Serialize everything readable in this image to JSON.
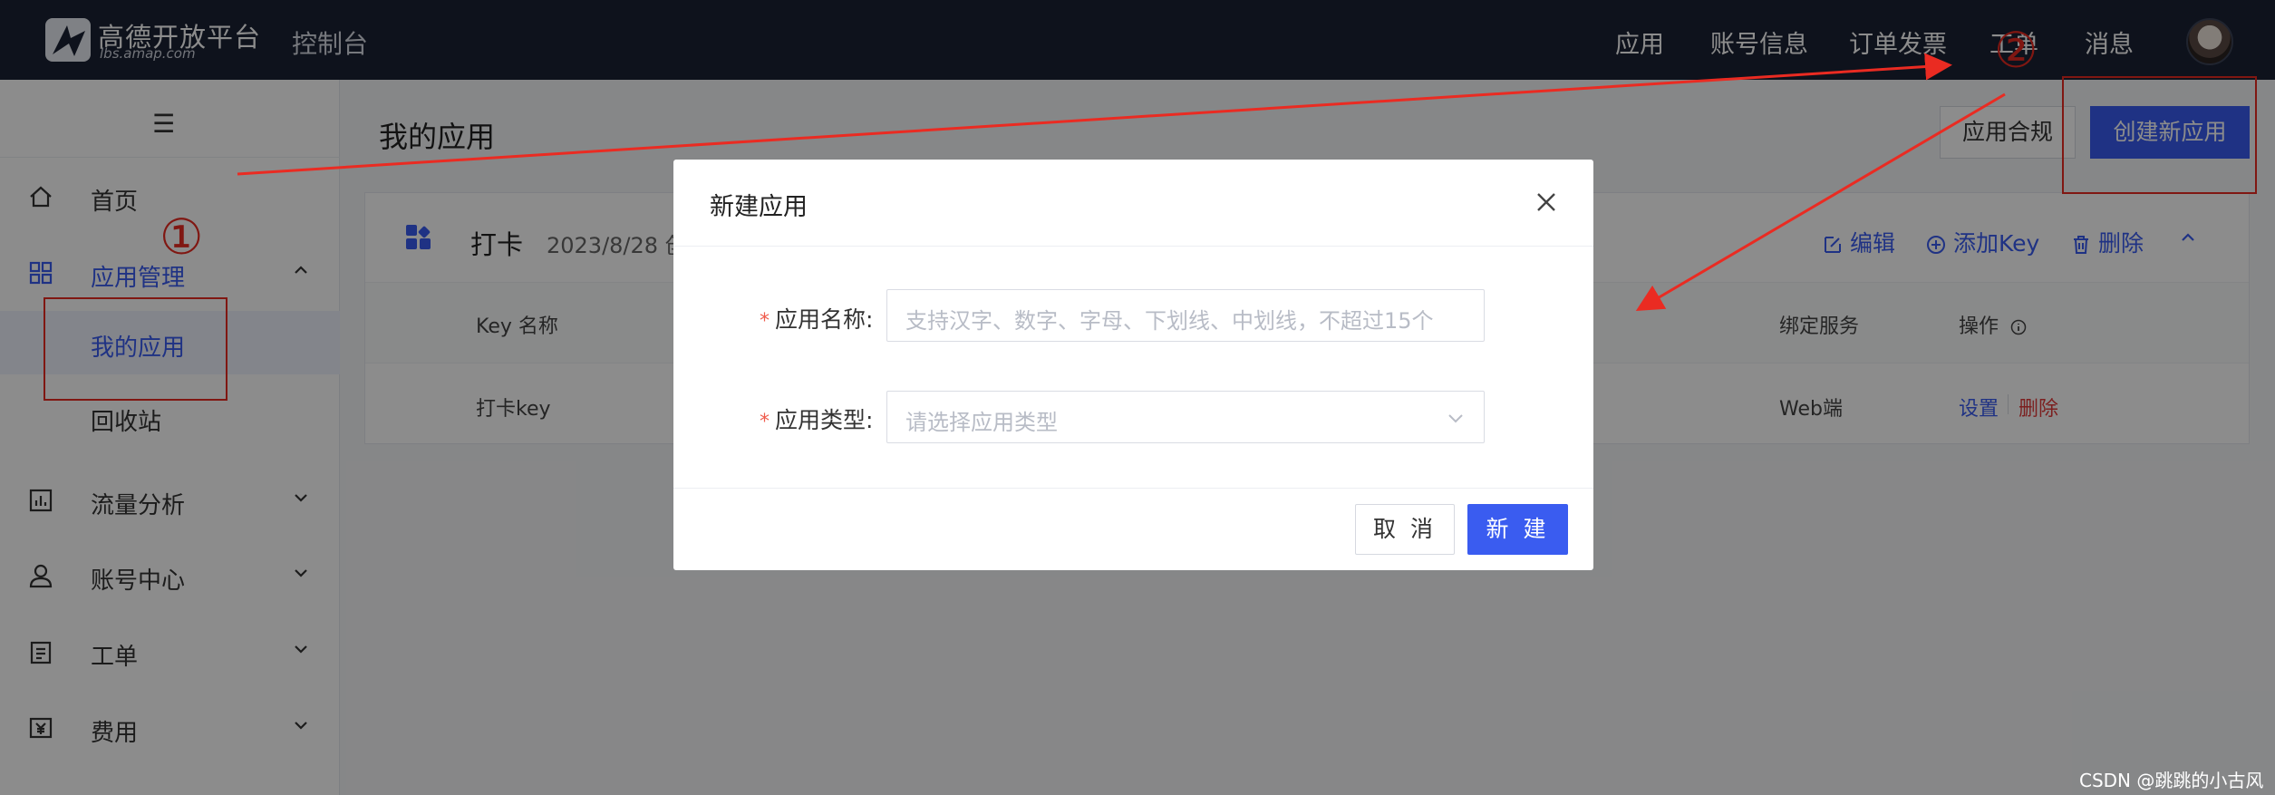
{
  "topbar": {
    "logo_text": "高德开放平台",
    "logo_sub": "lbs.amap.com",
    "console": "控制台",
    "nav": [
      "应用",
      "账号信息",
      "订单发票",
      "工单",
      "消息"
    ]
  },
  "sidebar": {
    "items": [
      {
        "label": "首页",
        "icon": "home-icon"
      },
      {
        "label": "应用管理",
        "icon": "grid-icon"
      },
      {
        "label": "我的应用"
      },
      {
        "label": "回收站"
      },
      {
        "label": "流量分析",
        "icon": "chart-icon"
      },
      {
        "label": "账号中心",
        "icon": "user-icon"
      },
      {
        "label": "工单",
        "icon": "clipboard-icon"
      },
      {
        "label": "费用",
        "icon": "yen-icon"
      }
    ]
  },
  "main": {
    "title": "我的应用",
    "compliance_button": "应用合规",
    "create_button": "创建新应用",
    "card": {
      "app_name": "打卡",
      "app_date": "2023/8/28 创",
      "actions": [
        "编辑",
        "添加Key",
        "删除"
      ],
      "columns": [
        "Key 名称",
        "绑定服务",
        "操作"
      ],
      "row": {
        "key_name": "打卡key",
        "service": "Web端",
        "set": "设置",
        "delete": "删除"
      }
    }
  },
  "annotations": {
    "one": "①",
    "two": "②"
  },
  "modal": {
    "title": "新建应用",
    "name_label": "应用名称:",
    "name_placeholder": "支持汉字、数字、字母、下划线、中划线，不超过15个",
    "type_label": "应用类型:",
    "type_placeholder": "请选择应用类型",
    "required_mark": "*",
    "cancel": "取 消",
    "ok": "新 建"
  },
  "watermark": "CSDN @跳跳的小古风",
  "colors": {
    "accent": "#3a5cf0",
    "topbar": "#1b2233",
    "annotation": "#ea2b22",
    "danger": "#e23a3a"
  }
}
